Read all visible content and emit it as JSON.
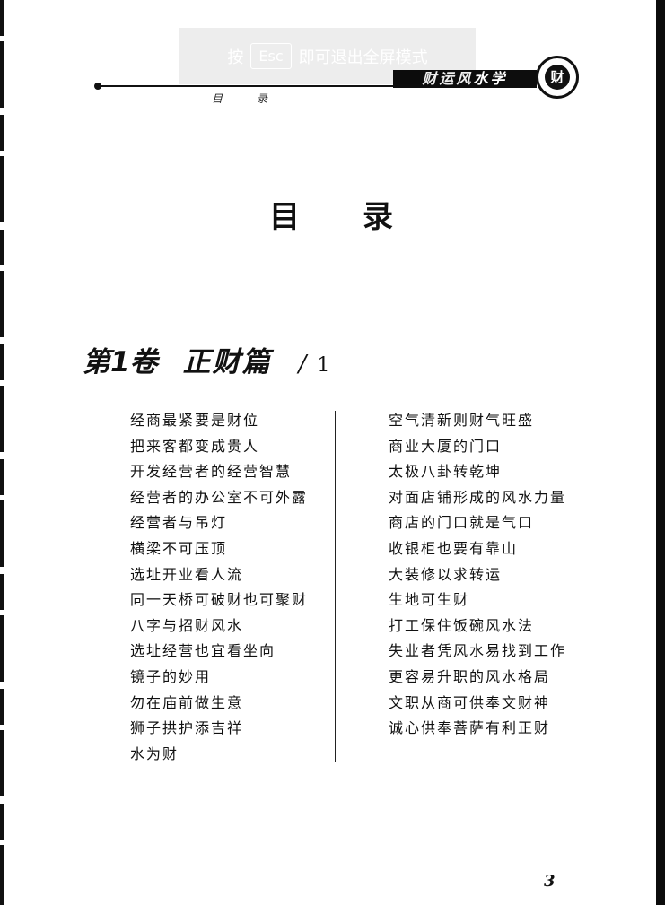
{
  "overlay": {
    "prefix": "按",
    "key": "Esc",
    "suffix": "即可退出全屏模式"
  },
  "header": {
    "book_title": "财运风水学",
    "logo_glyph": "财",
    "section_label": "目录"
  },
  "page_title": "目录",
  "volume": {
    "number": "第1卷",
    "name": "正财篇",
    "separator": "/",
    "page": "1"
  },
  "toc": {
    "left": [
      "经商最紧要是财位",
      "把来客都变成贵人",
      "开发经营者的经营智慧",
      "经营者的办公室不可外露",
      "经营者与吊灯",
      "横梁不可压顶",
      "选址开业看人流",
      "同一天桥可破财也可聚财",
      "八字与招财风水",
      "选址经营也宜看坐向",
      "镜子的妙用",
      "勿在庙前做生意",
      "狮子拱护添吉祥",
      "水为财"
    ],
    "right": [
      "空气清新则财气旺盛",
      "商业大厦的门口",
      "太极八卦转乾坤",
      "对面店铺形成的风水力量",
      "商店的门口就是气口",
      "收银柜也要有靠山",
      "大装修以求转运",
      "生地可生财",
      "打工保住饭碗风水法",
      "失业者凭风水易找到工作",
      "更容易升职的风水格局",
      "文职从商可供奉文财神",
      "诚心供奉菩萨有利正财"
    ]
  },
  "page_number": "3"
}
